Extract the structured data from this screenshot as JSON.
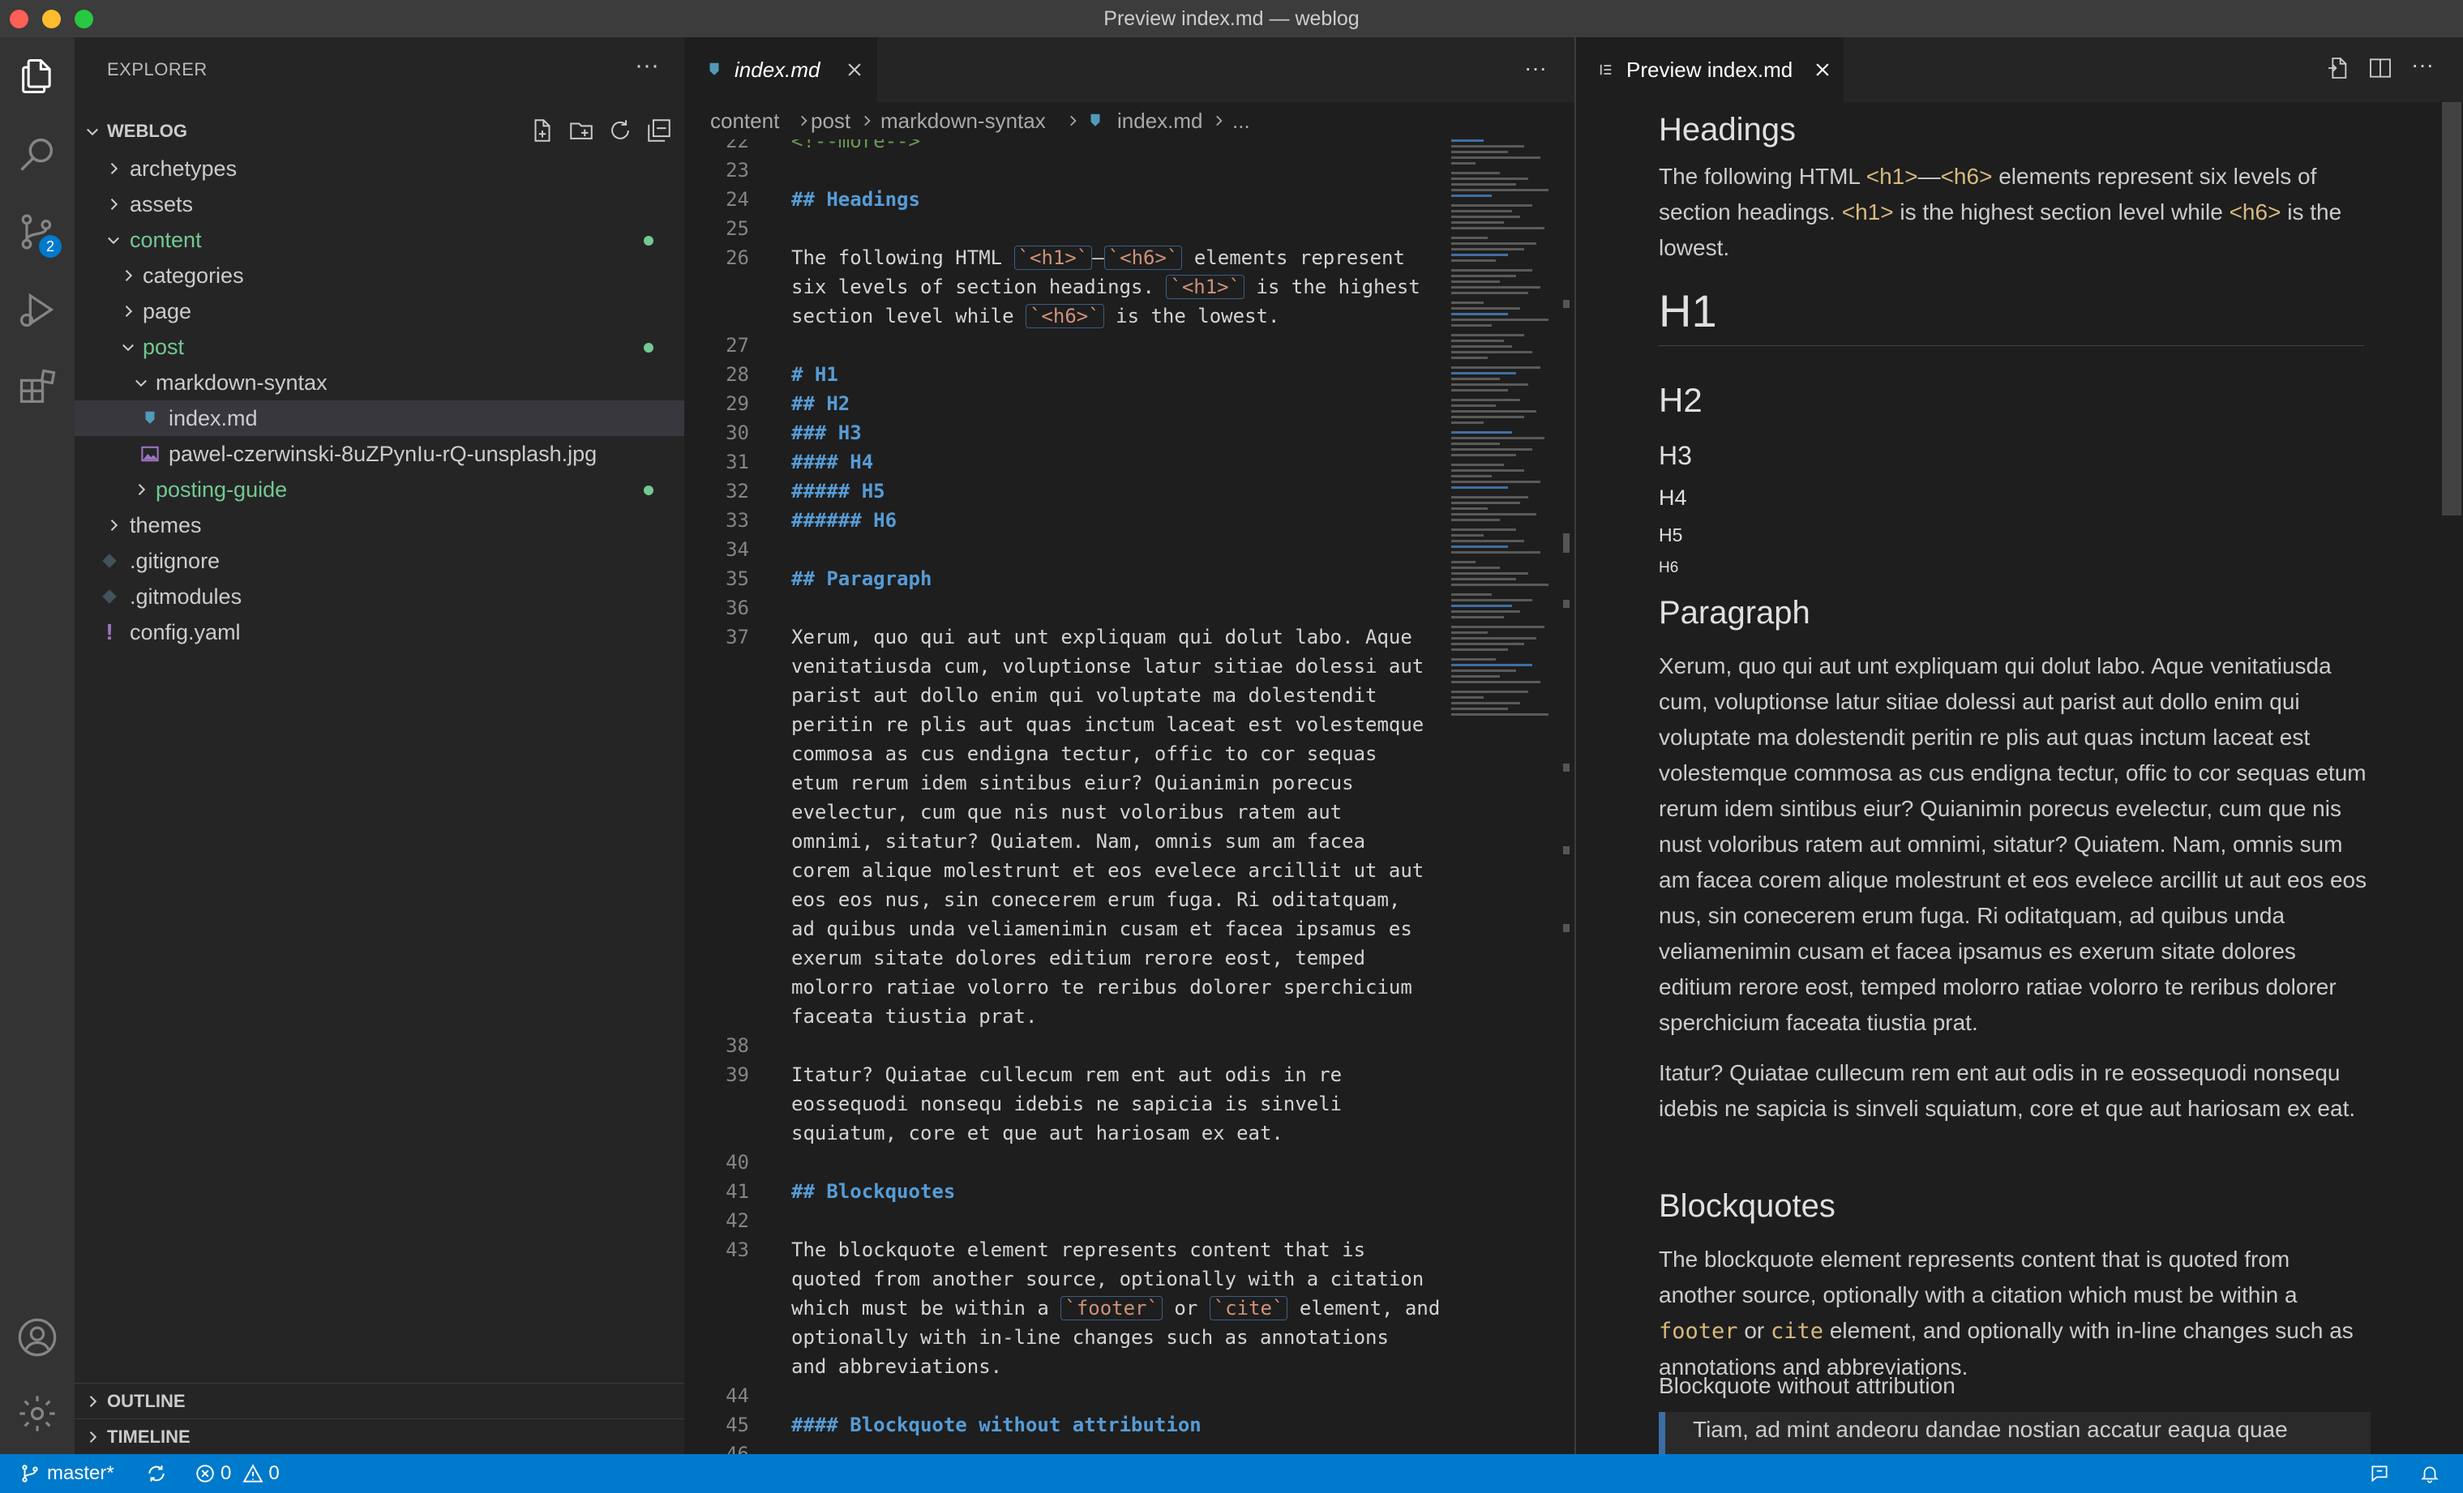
{
  "window": {
    "title": "Preview index.md — weblog"
  },
  "activity_bar": {
    "items": [
      "explorer-icon",
      "search-icon",
      "source-control-icon",
      "run-debug-icon",
      "extensions-icon"
    ],
    "source_control_badge": "2",
    "bottom": [
      "account-icon",
      "settings-gear-icon"
    ]
  },
  "sidebar": {
    "header": "EXPLORER",
    "more": "···",
    "root": "WEBLOG",
    "tree": [
      {
        "label": "archetypes",
        "type": "folder"
      },
      {
        "label": "assets",
        "type": "folder"
      },
      {
        "label": "content",
        "type": "folder-open",
        "modified": true
      },
      {
        "label": "categories",
        "type": "folder"
      },
      {
        "label": "page",
        "type": "folder"
      },
      {
        "label": "post",
        "type": "folder-open",
        "modified": true
      },
      {
        "label": "markdown-syntax",
        "type": "folder-open"
      },
      {
        "label": "index.md",
        "type": "markdown",
        "selected": true
      },
      {
        "label": "pawel-czerwinski-8uZPynIu-rQ-unsplash.jpg",
        "type": "image"
      },
      {
        "label": "posting-guide",
        "type": "folder",
        "modified": true
      },
      {
        "label": "themes",
        "type": "folder"
      },
      {
        "label": ".gitignore",
        "type": "git"
      },
      {
        "label": ".gitmodules",
        "type": "git"
      },
      {
        "label": "config.yaml",
        "type": "yaml"
      }
    ],
    "sections": [
      "OUTLINE",
      "TIMELINE"
    ]
  },
  "editor": {
    "tab_label": "index.md",
    "more": "···",
    "breadcrumb": [
      "content",
      "post",
      "markdown-syntax",
      "index.md",
      "..."
    ],
    "lines": [
      {
        "n": "22",
        "text": "<!--more-->"
      },
      {
        "n": "23",
        "text": ""
      },
      {
        "n": "24",
        "text": "## Headings"
      },
      {
        "n": "25",
        "text": ""
      },
      {
        "n": "26",
        "a": "The following HTML ",
        "c1": "`<h1>`",
        "dash": "—",
        "c2": "`<h6>`",
        "b": " elements represent"
      },
      {
        "n": "",
        "a": "six levels of section headings. ",
        "c1": "`<h1>`",
        "b": " is the highest"
      },
      {
        "n": "",
        "a": "section level while ",
        "c1": "`<h6>`",
        "b": " is the lowest."
      },
      {
        "n": "27",
        "text": ""
      },
      {
        "n": "28",
        "text": "# H1"
      },
      {
        "n": "29",
        "text": "## H2"
      },
      {
        "n": "30",
        "text": "### H3"
      },
      {
        "n": "31",
        "text": "#### H4"
      },
      {
        "n": "32",
        "text": "##### H5"
      },
      {
        "n": "33",
        "text": "###### H6"
      },
      {
        "n": "34",
        "text": ""
      },
      {
        "n": "35",
        "text": "## Paragraph"
      },
      {
        "n": "36",
        "text": ""
      },
      {
        "n": "37",
        "text": "Xerum, quo qui aut unt expliquam qui dolut labo. Aque"
      },
      {
        "n": "",
        "text": "venitatiusda cum, voluptionse latur sitiae dolessi aut"
      },
      {
        "n": "",
        "text": "parist aut dollo enim qui voluptate ma dolestendit"
      },
      {
        "n": "",
        "text": "peritin re plis aut quas inctum laceat est volestemque"
      },
      {
        "n": "",
        "text": "commosa as cus endigna tectur, offic to cor sequas"
      },
      {
        "n": "",
        "text": "etum rerum idem sintibus eiur? Quianimin porecus"
      },
      {
        "n": "",
        "text": "evelectur, cum que nis nust voloribus ratem aut"
      },
      {
        "n": "",
        "text": "omnimi, sitatur? Quiatem. Nam, omnis sum am facea"
      },
      {
        "n": "",
        "text": "corem alique molestrunt et eos evelece arcillit ut aut"
      },
      {
        "n": "",
        "text": "eos eos nus, sin conecerem erum fuga. Ri oditatquam,"
      },
      {
        "n": "",
        "text": "ad quibus unda veliamenimin cusam et facea ipsamus es"
      },
      {
        "n": "",
        "text": "exerum sitate dolores editium rerore eost, temped"
      },
      {
        "n": "",
        "text": "molorro ratiae volorro te reribus dolorer sperchicium"
      },
      {
        "n": "",
        "text": "faceata tiustia prat."
      },
      {
        "n": "38",
        "text": ""
      },
      {
        "n": "39",
        "text": "Itatur? Quiatae cullecum rem ent aut odis in re"
      },
      {
        "n": "",
        "text": "eossequodi nonsequ idebis ne sapicia is sinveli"
      },
      {
        "n": "",
        "text": "squiatum, core et que aut hariosam ex eat."
      },
      {
        "n": "40",
        "text": ""
      },
      {
        "n": "41",
        "text": "## Blockquotes"
      },
      {
        "n": "42",
        "text": ""
      },
      {
        "n": "43",
        "text": "The blockquote element represents content that is"
      },
      {
        "n": "",
        "text": "quoted from another source, optionally with a citation"
      },
      {
        "n": "",
        "a": "which must be within a ",
        "c1": "`footer`",
        "dash": " or ",
        "c2": "`cite`",
        "b": " element, and"
      },
      {
        "n": "",
        "text": "optionally with in-line changes such as annotations"
      },
      {
        "n": "",
        "text": "and abbreviations."
      },
      {
        "n": "44",
        "text": ""
      },
      {
        "n": "45",
        "text": "#### Blockquote without attribution"
      },
      {
        "n": "46",
        "text": ""
      }
    ]
  },
  "preview": {
    "tab_label": "Preview index.md",
    "headings_title": "Headings",
    "intro": {
      "a": "The following HTML ",
      "k1": "<h1>",
      "dash": "—",
      "k2": "<h6>",
      "b": " elements represent six levels of section headings. ",
      "k3": "<h1>",
      "c": " is the highest section level while ",
      "k4": "<h6>",
      "d": " is the lowest."
    },
    "h1": "H1",
    "h2": "H2",
    "h3": "H3",
    "h4": "H4",
    "h5": "H5",
    "h6": "H6",
    "paragraph_title": "Paragraph",
    "paragraph_1": "Xerum, quo qui aut unt expliquam qui dolut labo. Aque venitatiusda cum, voluptionse latur sitiae dolessi aut parist aut dollo enim qui voluptate ma dolestendit peritin re plis aut quas inctum laceat est volestemque commosa as cus endigna tectur, offic to cor sequas etum rerum idem sintibus eiur? Quianimin porecus evelectur, cum que nis nust voloribus ratem aut omnimi, sitatur? Quiatem. Nam, omnis sum am facea corem alique molestrunt et eos evelece arcillit ut aut eos eos nus, sin conecerem erum fuga. Ri oditatquam, ad quibus unda veliamenimin cusam et facea ipsamus es exerum sitate dolores editium rerore eost, temped molorro ratiae volorro te reribus dolorer sperchicium faceata tiustia prat.",
    "paragraph_2": "Itatur? Quiatae cullecum rem ent aut odis in re eossequodi nonsequ idebis ne sapicia is sinveli squiatum, core et que aut hariosam ex eat.",
    "blockquotes_title": "Blockquotes",
    "blockquotes_text": {
      "a": "The blockquote element represents content that is quoted from another source, optionally with a citation which must be within a ",
      "k1": "footer",
      "b": " or ",
      "k2": "cite",
      "c": " element, and optionally with in-line changes such as annotations and abbreviations."
    },
    "blockquote_sub": "Blockquote without attribution",
    "blockquote_partial": "Tiam, ad mint andeoru dandae nostian accatur eaqua quae"
  },
  "statusbar": {
    "branch": "master*",
    "errors": "0",
    "warnings": "0",
    "color": "#007acc"
  },
  "colors": {
    "accent": "#007acc",
    "heading_md": "#569cd6",
    "modified_folder": "#73c991",
    "inline_code": "#d7ba7d"
  }
}
